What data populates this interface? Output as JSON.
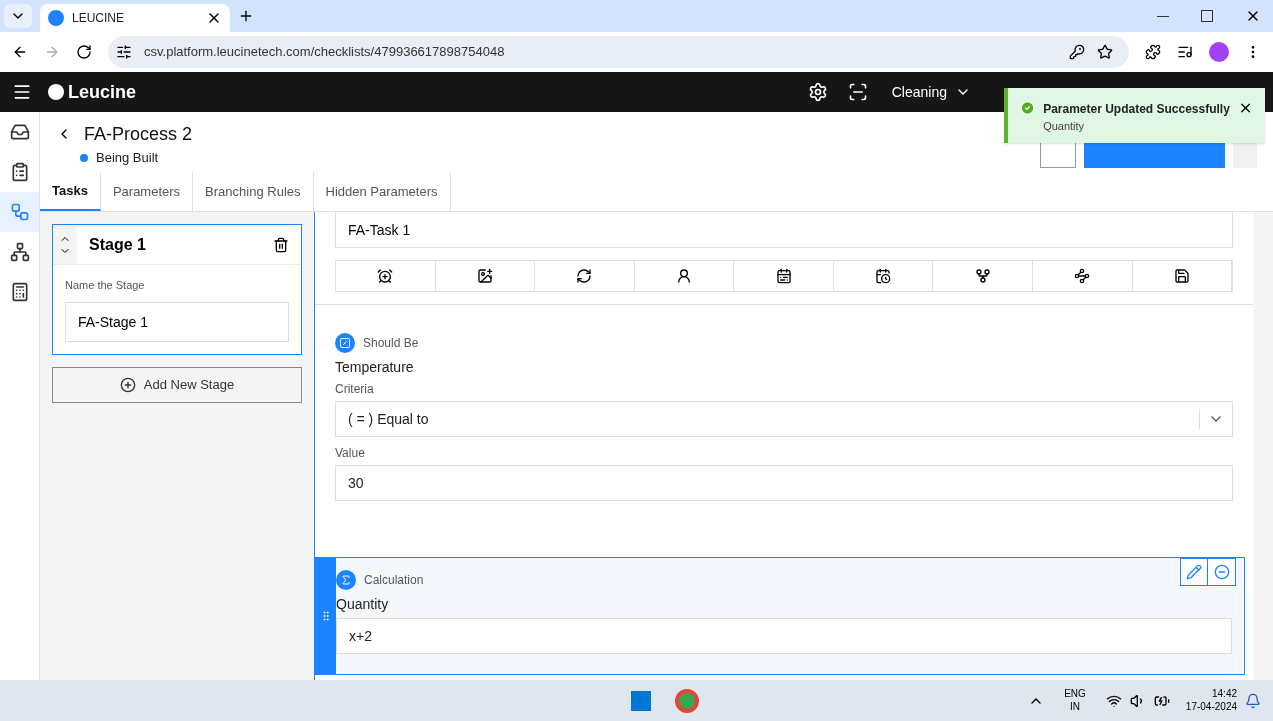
{
  "browser": {
    "tab_title": "LEUCINE",
    "url": "csv.platform.leucinetech.com/checklists/479936617898754048"
  },
  "header": {
    "brand": "Leucine",
    "facility": "Cleaning"
  },
  "toast": {
    "title": "Parameter Updated Successfully",
    "subtitle": "Quantity"
  },
  "nav": [
    {
      "selected": false
    },
    {
      "selected": false
    },
    {
      "selected": true
    },
    {
      "selected": false
    },
    {
      "selected": false
    }
  ],
  "page": {
    "title": "FA-Process 2",
    "status": {
      "label": "Being Built",
      "color": "#1d84ff"
    }
  },
  "tabs": [
    {
      "label": "Tasks",
      "selected": true
    },
    {
      "label": "Parameters",
      "selected": false
    },
    {
      "label": "Branching Rules",
      "selected": false
    },
    {
      "label": "Hidden Parameters",
      "selected": false
    }
  ],
  "stage": {
    "title": "Stage 1",
    "name_label": "Name the Stage",
    "name_value": "FA-Stage 1"
  },
  "add_stage": "Add New Stage",
  "task": {
    "name": "FA-Task 1"
  },
  "parameters": [
    {
      "kind": "should_be",
      "type_label": "Should Be",
      "label": "Temperature",
      "criteria_label": "Criteria",
      "criteria_value": "( = ) Equal to",
      "value_label": "Value",
      "value": "30",
      "selected": false
    },
    {
      "kind": "calculation",
      "type_label": "Calculation",
      "label": "Quantity",
      "expression": "x+2",
      "selected": true
    }
  ],
  "taskbar": {
    "lang": "ENG",
    "region": "IN",
    "time": "14:42",
    "date": "17-04-2024"
  }
}
